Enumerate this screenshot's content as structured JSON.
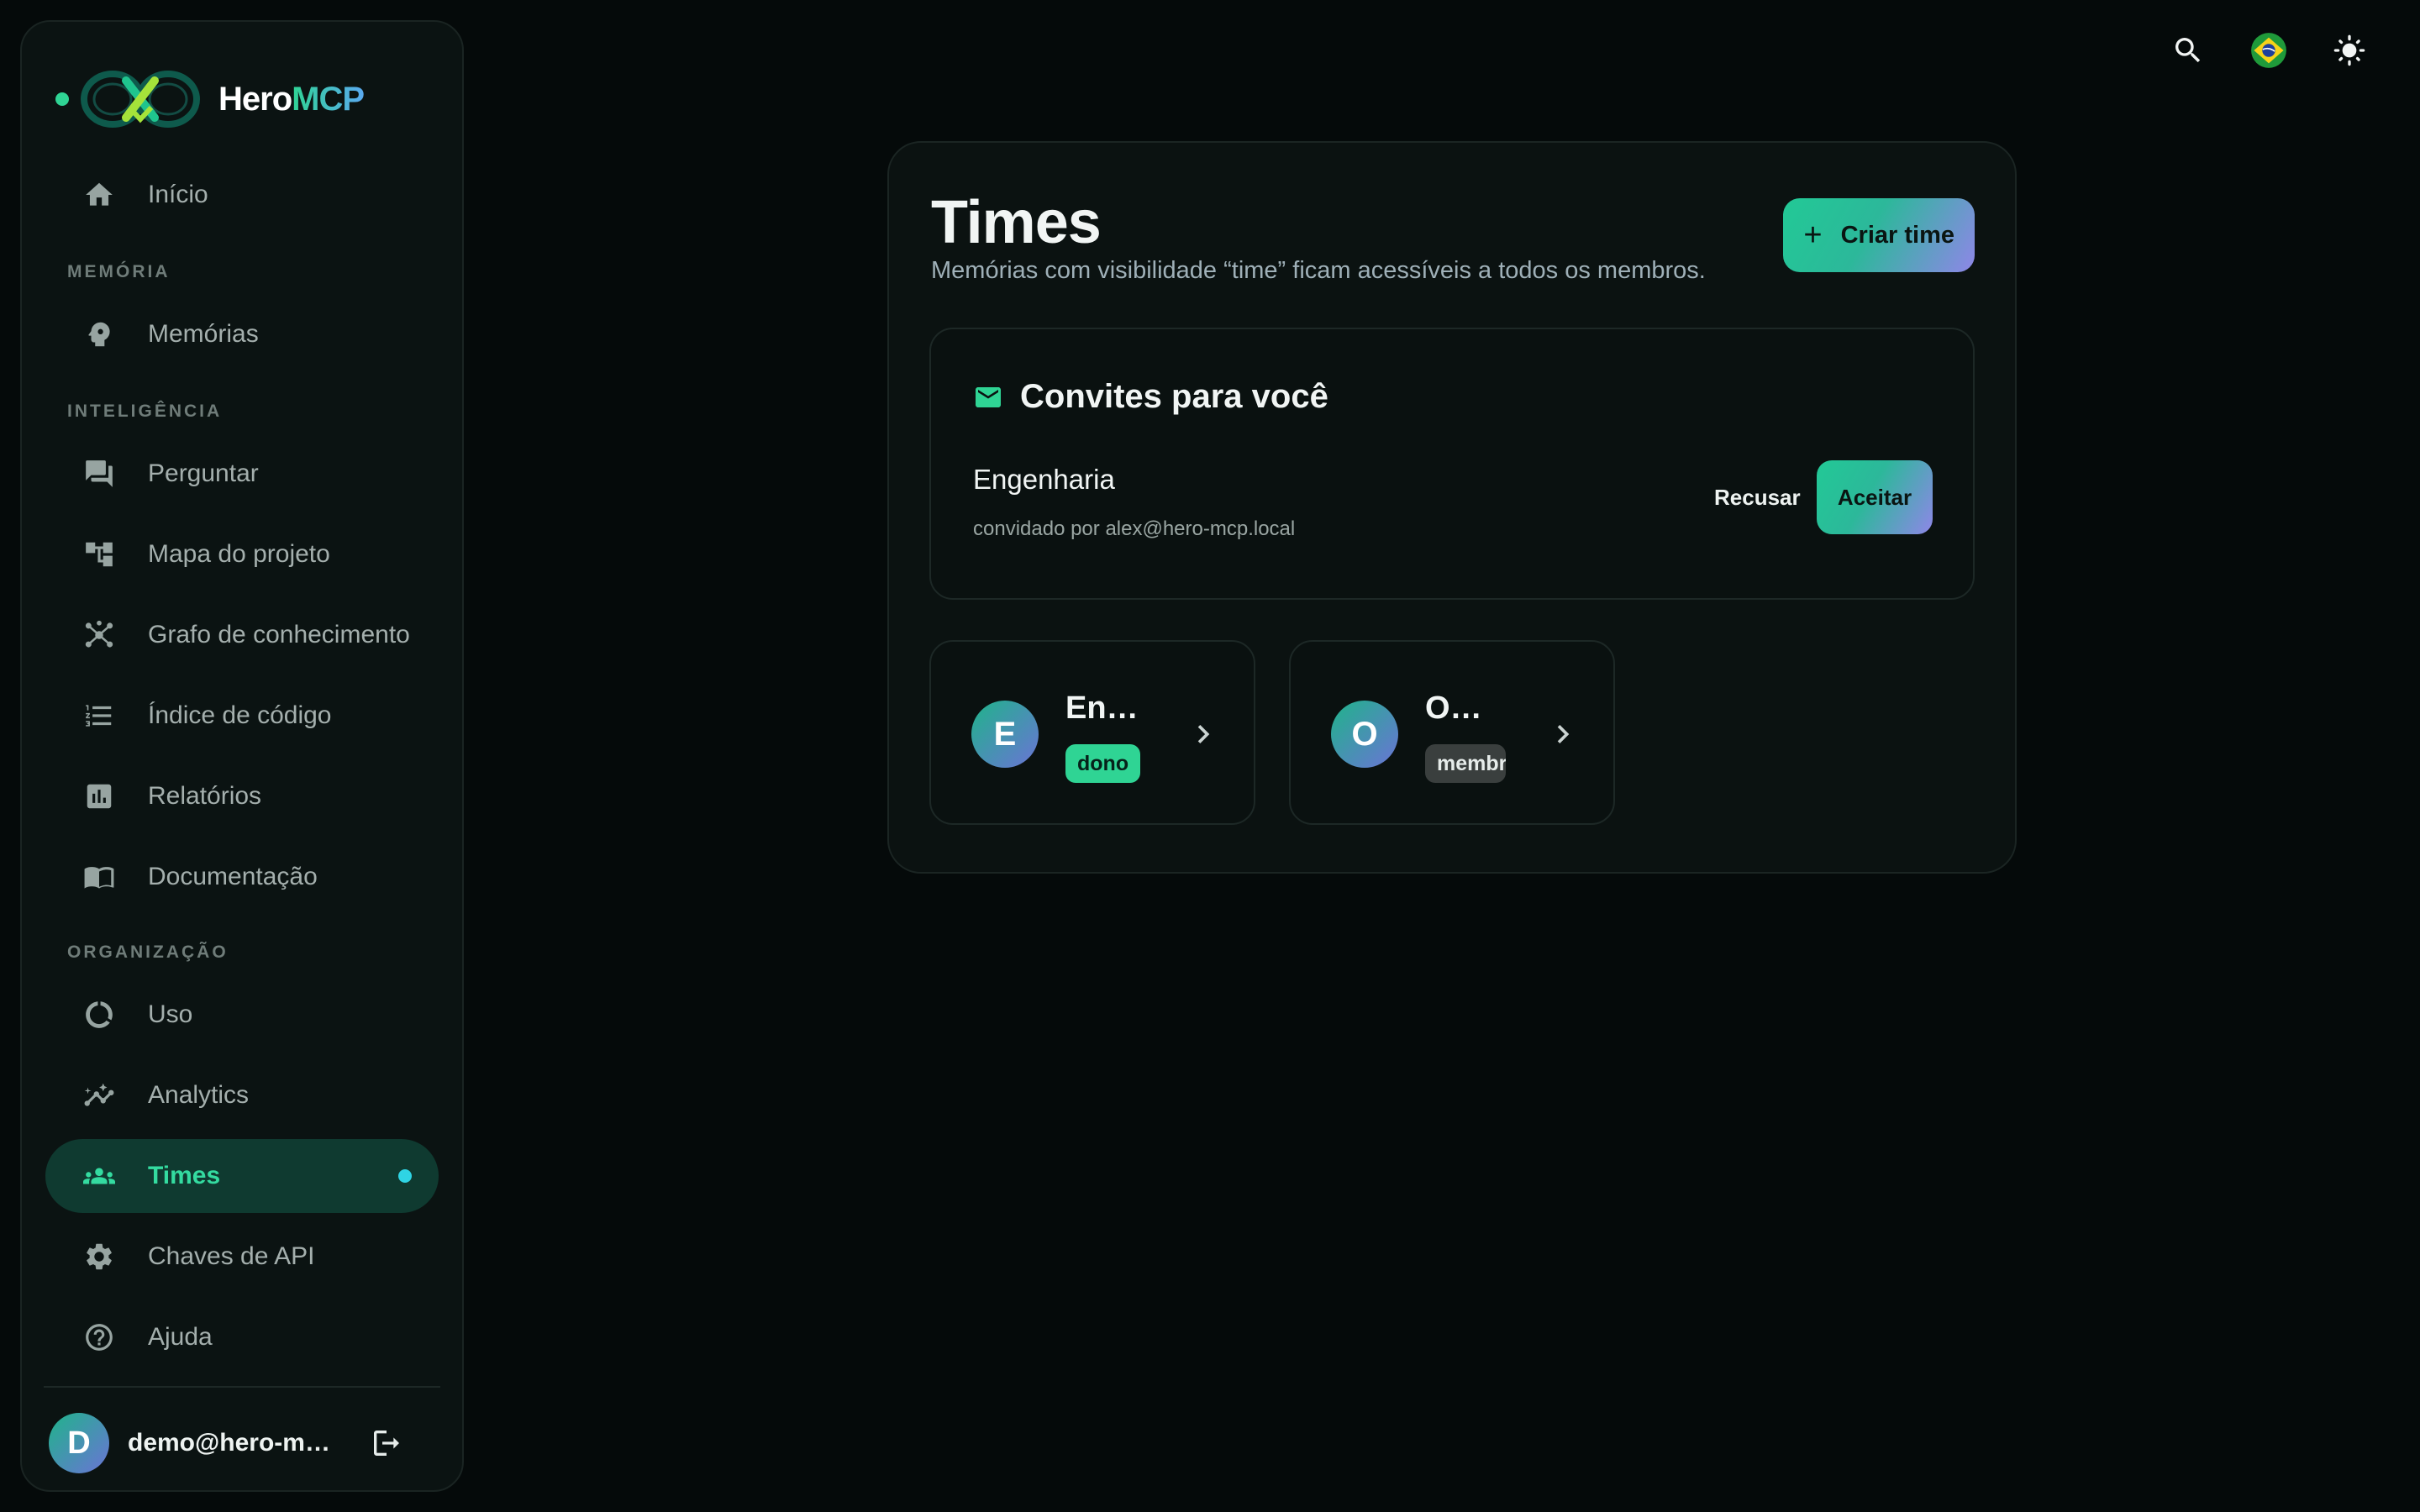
{
  "brand": {
    "name_part1": "Hero",
    "name_part2": "MCP"
  },
  "sidebar": {
    "sections": {
      "memoria": "MEMÓRIA",
      "inteligencia": "INTELIGÊNCIA",
      "organizacao": "ORGANIZAÇÃO"
    },
    "items": [
      {
        "label": "Início",
        "icon": "home-icon"
      },
      {
        "label": "Memórias",
        "icon": "brain-icon"
      },
      {
        "label": "Perguntar",
        "icon": "chat-icon"
      },
      {
        "label": "Mapa do projeto",
        "icon": "tree-icon"
      },
      {
        "label": "Grafo de conhecimento",
        "icon": "graph-icon"
      },
      {
        "label": "Índice de código",
        "icon": "list-icon"
      },
      {
        "label": "Relatórios",
        "icon": "bar-chart-icon"
      },
      {
        "label": "Documentação",
        "icon": "book-icon"
      },
      {
        "label": "Uso",
        "icon": "usage-ring-icon"
      },
      {
        "label": "Analytics",
        "icon": "analytics-icon"
      },
      {
        "label": "Times",
        "icon": "group-icon",
        "active": true
      },
      {
        "label": "Chaves de API",
        "icon": "gear-icon"
      },
      {
        "label": "Ajuda",
        "icon": "help-icon"
      }
    ],
    "user": {
      "initial": "D",
      "email": "demo@hero-mcp.local"
    }
  },
  "main": {
    "title": "Times",
    "subtitle": "Memórias com visibilidade “time” ficam acessíveis a todos os membros.",
    "create_button": "Criar time",
    "invites": {
      "title": "Convites para você",
      "items": [
        {
          "team": "Engenharia",
          "invited_by": "convidado por alex@hero-mcp.local",
          "decline": "Recusar",
          "accept": "Aceitar"
        }
      ]
    },
    "teams": [
      {
        "initial": "E",
        "name": "Engenharia",
        "role": "dono"
      },
      {
        "initial": "O",
        "name": "Operações",
        "role": "membro"
      }
    ]
  },
  "colors": {
    "accent": "#2fd494",
    "active_bg": "#0f3a30",
    "background": "#050a0a"
  }
}
